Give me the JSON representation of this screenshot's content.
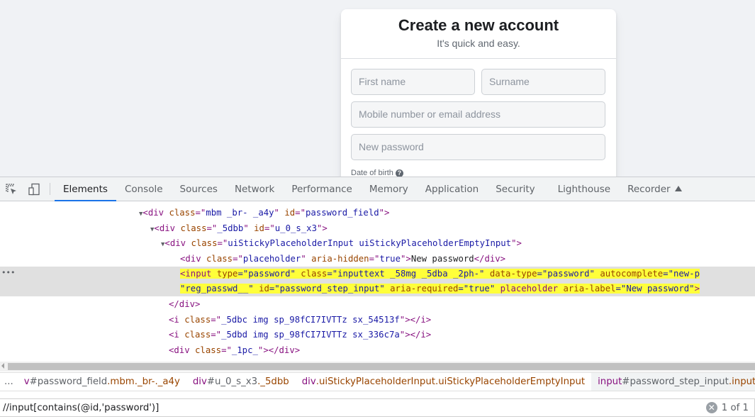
{
  "page": {
    "title": "Create a new account",
    "subtitle": "It's quick and easy.",
    "fields": {
      "first_name": "First name",
      "surname": "Surname",
      "contact": "Mobile number or email address",
      "password": "New password"
    },
    "dob_label": "Date of birth",
    "help_glyph": "?"
  },
  "devtools": {
    "tools": {
      "inspect": "inspect-element-icon",
      "device": "device-toolbar-icon"
    },
    "tabs": [
      {
        "label": "Elements",
        "active": true
      },
      {
        "label": "Console"
      },
      {
        "label": "Sources"
      },
      {
        "label": "Network"
      },
      {
        "label": "Performance"
      },
      {
        "label": "Memory"
      },
      {
        "label": "Application"
      },
      {
        "label": "Security"
      },
      {
        "label": "Lighthouse"
      },
      {
        "label": "Recorder"
      }
    ],
    "dom": {
      "l1": {
        "tag": "div",
        "attrs": [
          [
            "class",
            "mbm _br- _a4y"
          ],
          [
            "id",
            "password_field"
          ]
        ]
      },
      "l2": {
        "tag": "div",
        "attrs": [
          [
            "class",
            "_5dbb"
          ],
          [
            "id",
            "u_0_s_x3"
          ]
        ]
      },
      "l3": {
        "tag": "div",
        "attrs": [
          [
            "class",
            "uiStickyPlaceholderInput uiStickyPlaceholderEmptyInput"
          ]
        ]
      },
      "l4": {
        "tag": "div",
        "attrs": [
          [
            "class",
            "placeholder"
          ],
          [
            "aria-hidden",
            "true"
          ]
        ],
        "text": "New password"
      },
      "l5a": "<input type=\"password\" class=\"inputtext _58mg _5dba _2ph-\" data-type=\"password\" autocomplete=\"new-p",
      "l5b": "\"reg_passwd__\" id=\"password_step_input\" aria-required=\"true\" placeholder aria-label=\"New password\">",
      "l6": "</div>",
      "l7": {
        "tag": "i",
        "attrs": [
          [
            "class",
            "_5dbc img sp_98fCI7IVTTz sx_54513f"
          ]
        ]
      },
      "l8": {
        "tag": "i",
        "attrs": [
          [
            "class",
            "_5dbd img sp_98fCI7IVTTz sx_336c7a"
          ]
        ]
      },
      "l9": {
        "tag": "div",
        "attrs": [
          [
            "class",
            "_1pc_"
          ]
        ]
      }
    },
    "breadcrumbs": [
      {
        "tag": "v",
        "id": "#password_field",
        "cls": ".mbm._br-._a4y"
      },
      {
        "tag": "div",
        "id": "#u_0_s_x3",
        "cls": "._5dbb"
      },
      {
        "tag": "div",
        "id": "",
        "cls": ".uiStickyPlaceholderInput.uiStickyPlaceholderEmptyInput"
      },
      {
        "tag": "input",
        "id": "#password_step_input",
        "cls": ".inputtext.",
        "active": true
      }
    ],
    "more": "...",
    "search": {
      "value": "//input[contains(@id,'password')]",
      "count": "1 of 1",
      "clear_glyph": "✕"
    }
  },
  "colors": {
    "accent": "#1a73e8",
    "highlight": "#ffff3a",
    "tag": "#881280",
    "attr_name": "#994500",
    "attr_value": "#1a1aa6"
  }
}
